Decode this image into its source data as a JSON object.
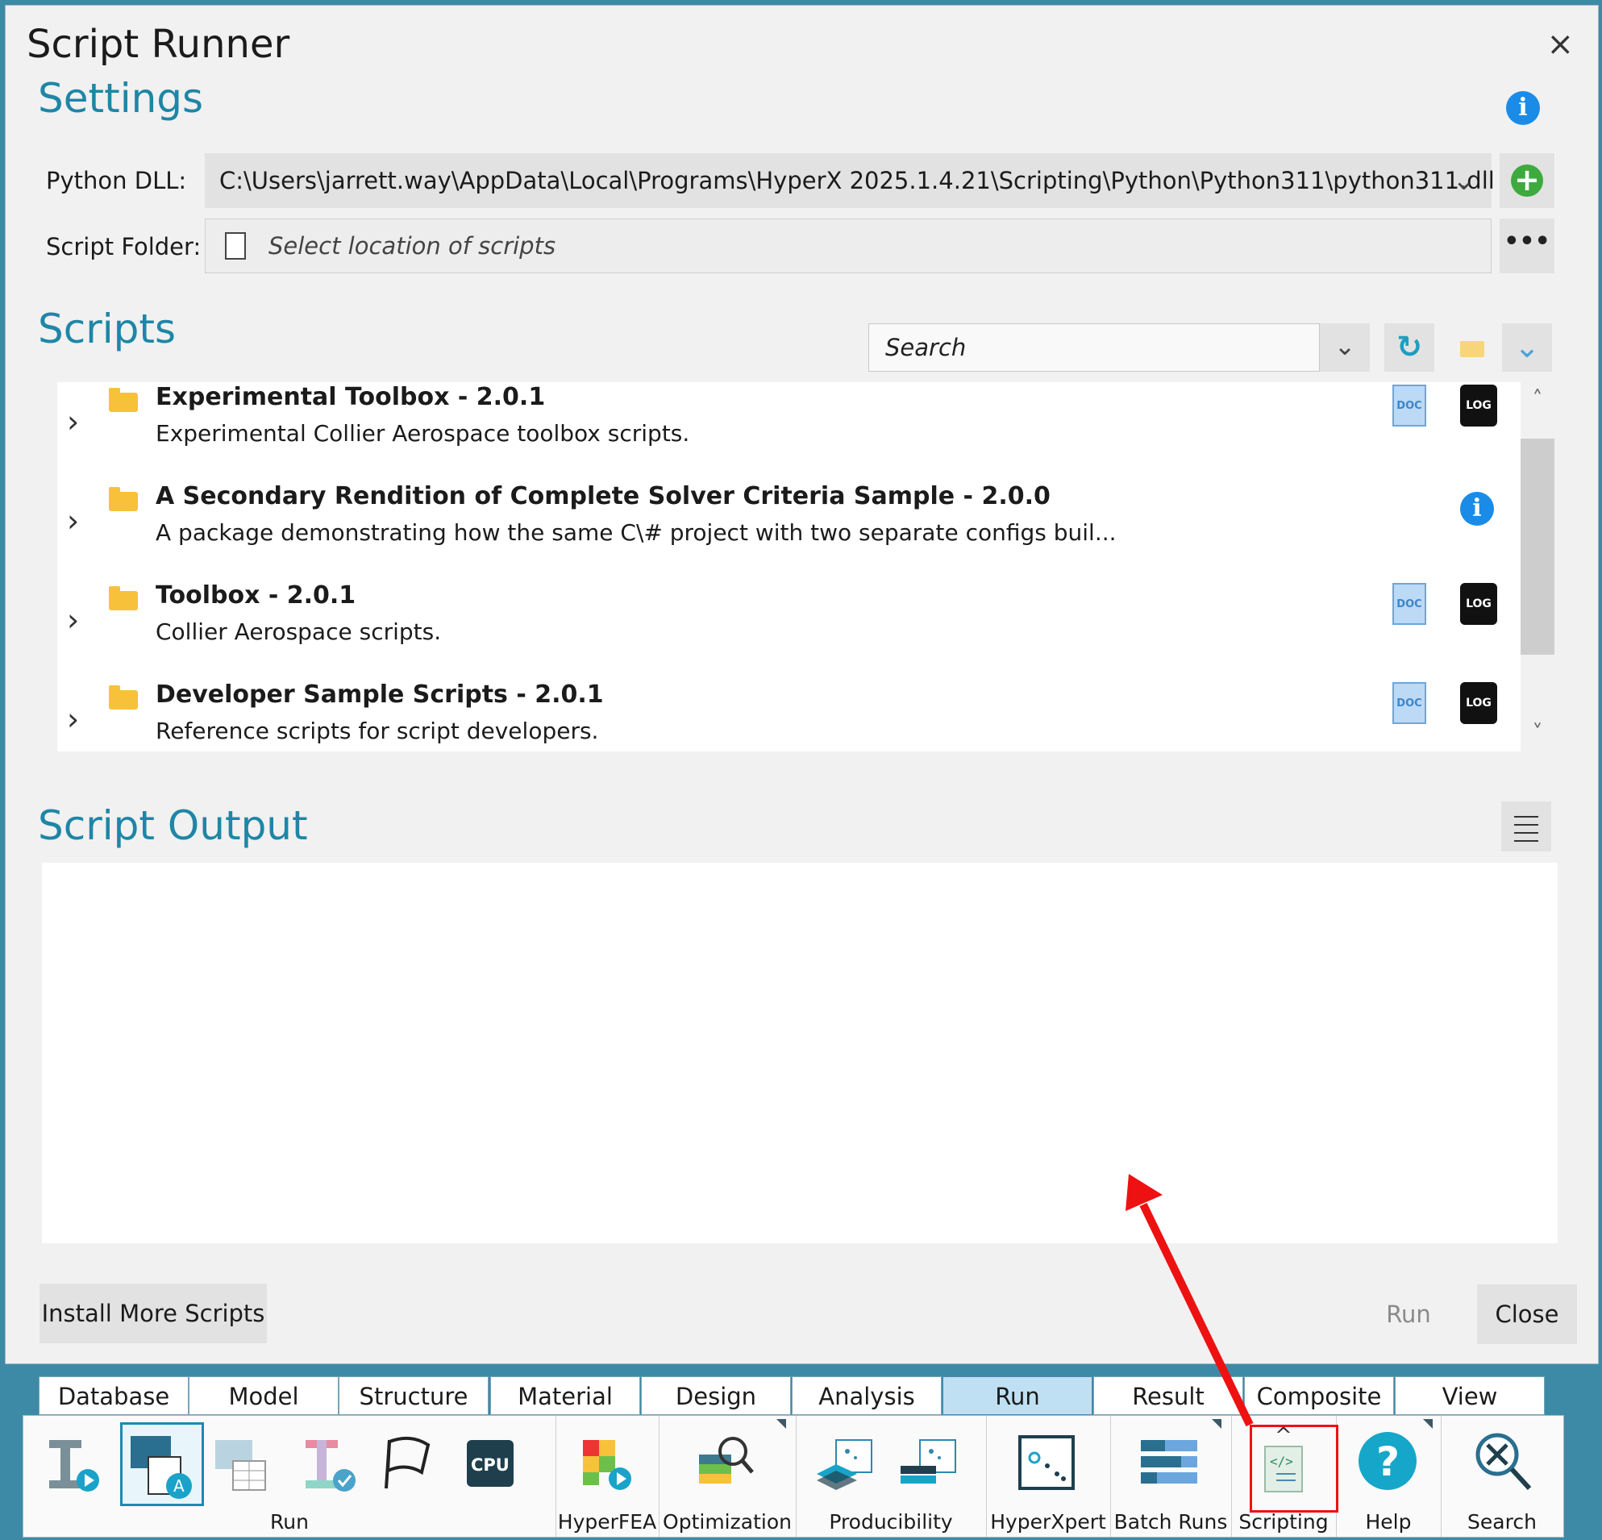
{
  "window": {
    "title": "Script Runner",
    "close_glyph": "×"
  },
  "settings": {
    "heading": "Settings",
    "python_dll_label": "Python DLL:",
    "python_dll_value": "C:\\Users\\jarrett.way\\AppData\\Local\\Programs\\HyperX 2025.1.4.21\\Scripting\\Python\\Python311\\python311.dll",
    "script_folder_label": "Script Folder:",
    "script_folder_placeholder": "Select location of scripts"
  },
  "scripts": {
    "heading": "Scripts",
    "search_placeholder": "Search",
    "items": [
      {
        "name": "Experimental Toolbox - 2.0.1",
        "description": "Experimental Collier Aerospace toolbox scripts.",
        "icons": [
          "doc-icon",
          "log-icon"
        ]
      },
      {
        "name": "A Secondary Rendition of Complete Solver Criteria Sample - 2.0.0",
        "description": "A package demonstrating how the same C\\# project with two separate configs buil...",
        "icons": [
          "info-icon"
        ]
      },
      {
        "name": "Toolbox - 2.0.1",
        "description": "Collier Aerospace scripts.",
        "icons": [
          "doc-icon",
          "log-icon"
        ]
      },
      {
        "name": "Developer Sample Scripts - 2.0.1",
        "description": "Reference scripts for script developers.",
        "icons": [
          "doc-icon",
          "log-icon"
        ]
      }
    ],
    "doc_text": "DOC",
    "log_text": "LOG"
  },
  "output": {
    "heading": "Script Output"
  },
  "footer": {
    "install_label": "Install More Scripts",
    "run_label": "Run",
    "close_label": "Close"
  },
  "ribbon": {
    "tabs": [
      "Database",
      "Model",
      "Structure",
      "Material",
      "Design",
      "Analysis",
      "Run",
      "Result",
      "Composite",
      "View"
    ],
    "active_tab": "Run",
    "groups": {
      "run": "Run",
      "hyperfea": "HyperFEA",
      "optimization": "Optimization",
      "producibility": "Producibility",
      "hyperxpert": "HyperXpert",
      "batch_runs": "Batch Runs",
      "scripting": "Scripting",
      "help": "Help",
      "search": "Search"
    },
    "cpu_text": "CPU"
  },
  "colors": {
    "accent": "#1e86a6",
    "info_blue": "#1a8ce8",
    "add_green": "#3eaa3e",
    "folder_yellow": "#f7c23a",
    "highlight_red": "#e11111",
    "ribbon_bg": "#3d8aa6"
  }
}
